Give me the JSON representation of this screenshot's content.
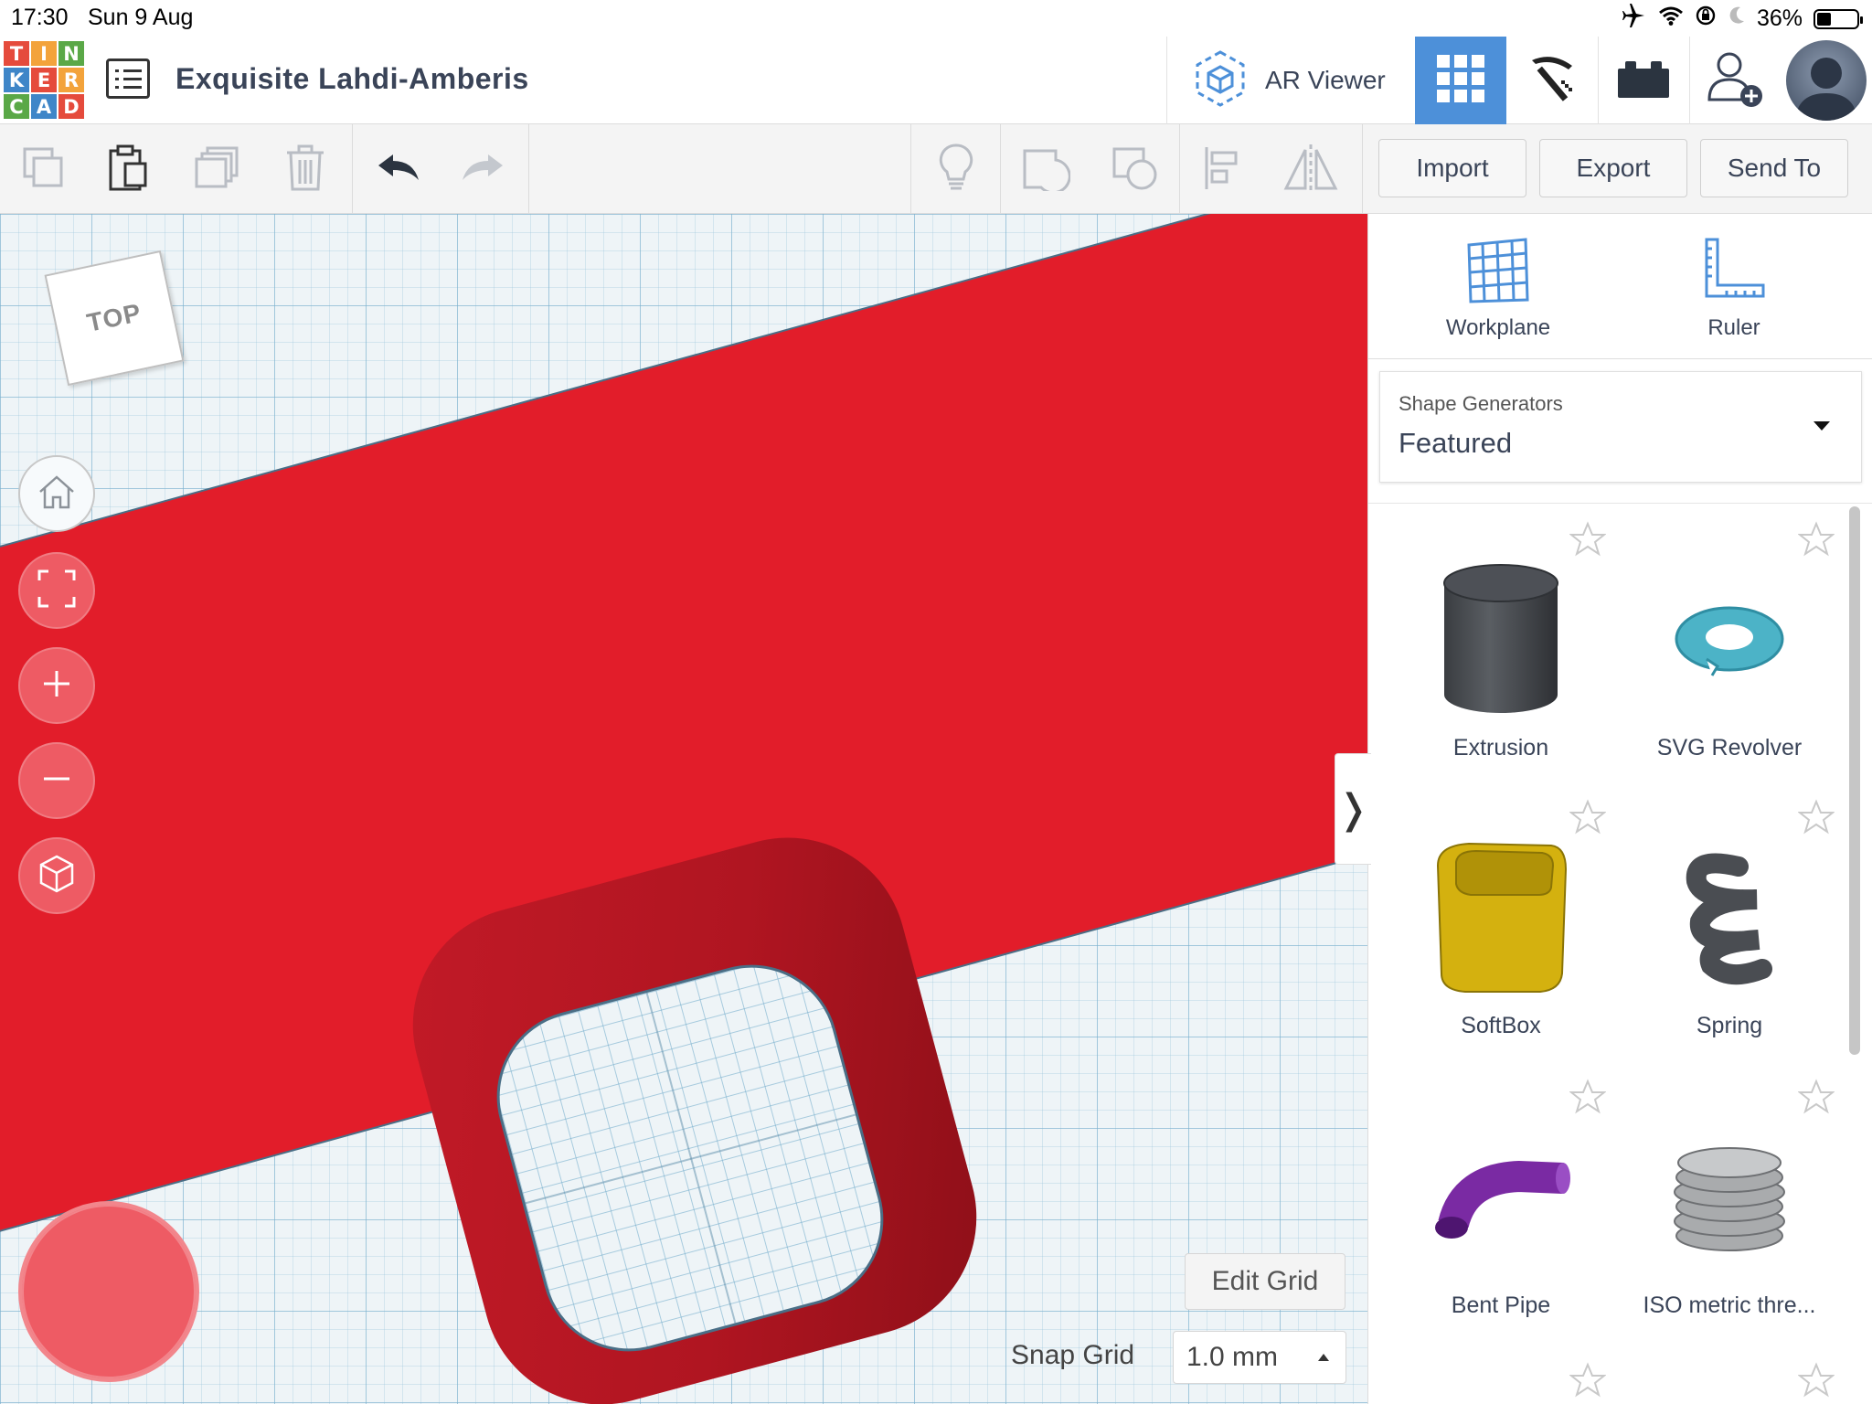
{
  "status_bar": {
    "time": "17:30",
    "date": "Sun 9 Aug",
    "battery": "36%",
    "battery_level": 0.36,
    "icons": [
      "airplane-icon",
      "wifi-icon",
      "orientation-lock-icon",
      "moon-icon",
      "battery-icon"
    ]
  },
  "header": {
    "logo_letters": [
      "T",
      "I",
      "N",
      "K",
      "E",
      "R",
      "C",
      "A",
      "D"
    ],
    "logo_colors": [
      "#e54b3c",
      "#f3a33b",
      "#5aa847",
      "#3f86c8",
      "#e54b3c",
      "#f3a33b",
      "#5aa847",
      "#3f86c8",
      "#e54b3c"
    ],
    "design_title": "Exquisite Lahdi-Amberis",
    "ar_viewer_label": "AR Viewer",
    "accent_color": "#4d90d9"
  },
  "toolbar": {
    "import_label": "Import",
    "export_label": "Export",
    "send_to_label": "Send To"
  },
  "workplane": {
    "viewcube_label": "TOP",
    "plane_color": "#e21d2a",
    "edit_grid_label": "Edit Grid",
    "snap_grid_label": "Snap Grid",
    "snap_grid_value": "1.0 mm"
  },
  "panel": {
    "workplane_label": "Workplane",
    "ruler_label": "Ruler",
    "dropdown_caption": "Shape Generators",
    "dropdown_value": "Featured",
    "shapes": [
      {
        "name": "Extrusion",
        "color": "#4a4d52"
      },
      {
        "name": "SVG Revolver",
        "color": "#4cb3c7"
      },
      {
        "name": "SoftBox",
        "color": "#d4b10f"
      },
      {
        "name": "Spring",
        "color": "#4a4d52"
      },
      {
        "name": "Bent Pipe",
        "color": "#7a2aa3"
      },
      {
        "name": "ISO metric thre...",
        "color": "#a9abad"
      }
    ]
  }
}
